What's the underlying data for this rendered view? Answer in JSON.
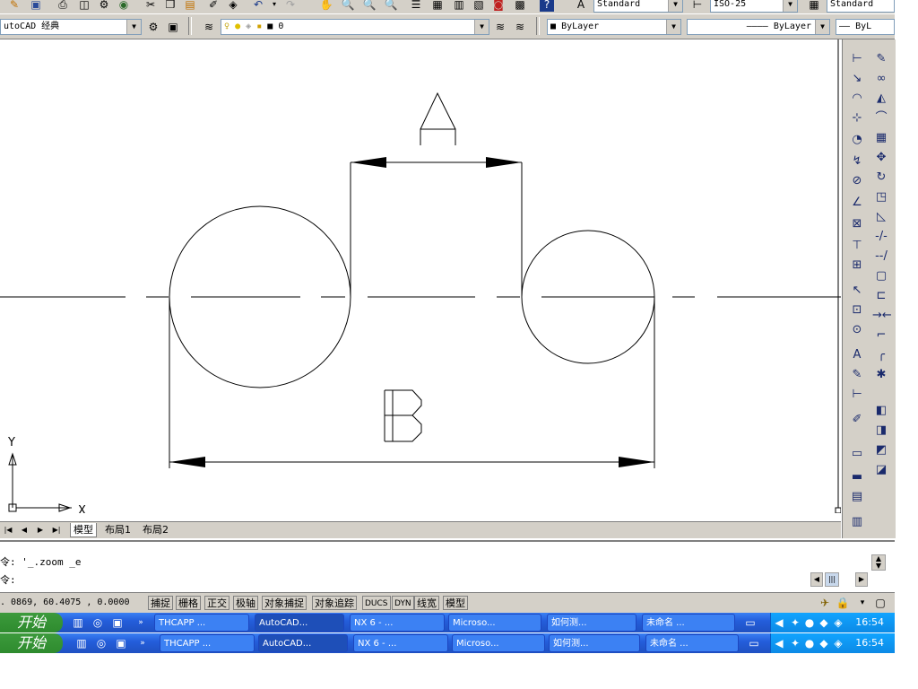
{
  "toolbar_top": {
    "text_style": "Standard",
    "dim_style": "ISO-25",
    "table_style": "Standard"
  },
  "toolbar_second": {
    "workspace": "utoCAD 经典",
    "layer": "0",
    "color": "ByLayer",
    "linetype": "ByLayer",
    "lineweight": "ByL"
  },
  "drawing": {
    "label_a": "A",
    "label_b": "B",
    "ucs_y": "Y",
    "ucs_x": "X"
  },
  "layout_tabs": [
    "模型",
    "布局1",
    "布局2"
  ],
  "command": {
    "history_line": "令: '_.zoom _e",
    "prompt_line": "令:"
  },
  "status_bar": {
    "coordinates": ". 0869, 60.4075 , 0.0000",
    "toggles": [
      "捕捉",
      "栅格",
      "正交",
      "极轴",
      "对象捕捉",
      "对象追踪",
      "DUCS",
      "DYN",
      "线宽",
      "模型"
    ]
  },
  "taskbar": {
    "start_label": "开始",
    "buttons": [
      "THCAPP ...",
      "AutoCAD...",
      "NX 6 - ...",
      "Microso...",
      "如何测...",
      "未命名 ..."
    ],
    "clock": "16:54"
  }
}
